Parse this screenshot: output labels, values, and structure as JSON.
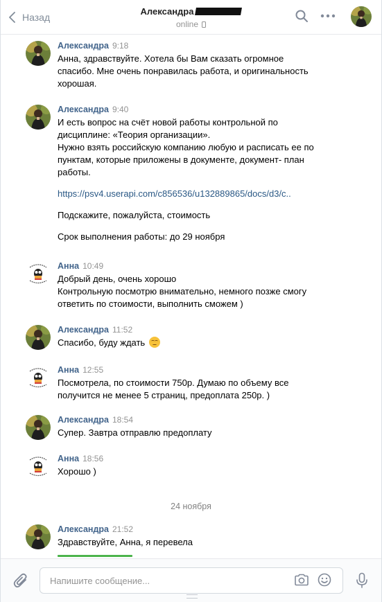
{
  "header": {
    "back_label": "Назад",
    "contact_name": "Александра",
    "status": "online"
  },
  "messages": [
    {
      "author": "Александра",
      "time": "9:18",
      "avatar": "photo-avatar",
      "lines": [
        "Анна, здравствуйте. Хотела бы Вам сказать огромное",
        "спасибо. Мне очень понравилась работа, и оригинальность",
        "хорошая."
      ]
    },
    {
      "author": "Александра",
      "time": "9:40",
      "avatar": "photo-avatar",
      "lines": [
        "И есть вопрос на счёт новой работы контрольной по",
        "дисциплине: «Теория организации».",
        "Нужно взять российскую компанию любую и расписать ее по",
        "пунктам, которые приложены в документе, документ- план",
        "работы.",
        "",
        "https://psv4.userapi.com/c856536/u132889865/docs/d3/c..",
        "",
        "Подскажите, пожалуйста, стоимость",
        "",
        "Срок выполнения работы: до 29 ноября"
      ]
    },
    {
      "author": "Анна",
      "time": "10:49",
      "avatar": "cartoon-avatar",
      "lines": [
        "Добрый день, очень хорошо",
        "Контрольную посмотрю внимательно, немного позже смогу",
        "ответить по стоимости, выполнить сможем )"
      ]
    },
    {
      "author": "Александра",
      "time": "11:52",
      "avatar": "photo-avatar",
      "lines": [
        "Спасибо, буду ждать"
      ],
      "emoji": "relieved-face-emoji"
    },
    {
      "author": "Анна",
      "time": "12:55",
      "avatar": "cartoon-avatar",
      "lines": [
        "Посмотрела, по стоимости 750р. Думаю по объему все",
        "получится не менее 5 страниц, предоплата 250р. )"
      ]
    },
    {
      "author": "Александра",
      "time": "18:54",
      "avatar": "photo-avatar",
      "lines": [
        "Супер. Завтра отправлю предоплату"
      ]
    },
    {
      "author": "Анна",
      "time": "18:56",
      "avatar": "cartoon-avatar",
      "lines": [
        "Хорошо )"
      ]
    },
    {
      "author": "Александра",
      "time": "21:52",
      "avatar": "photo-avatar",
      "lines": [
        "Здравствуйте, Анна, я перевела"
      ]
    }
  ],
  "date_separator": "24 ноября",
  "composer": {
    "placeholder": "Напишите сообщение..."
  },
  "colors": {
    "author_name": "#42648b",
    "link": "#2a5885",
    "timestamp": "#939393",
    "upload_progress": "#4bb34b"
  },
  "icons": [
    "chevron-left-icon",
    "phone-icon",
    "search-icon",
    "more-icon",
    "paperclip-icon",
    "camera-icon",
    "smile-icon",
    "microphone-icon"
  ]
}
